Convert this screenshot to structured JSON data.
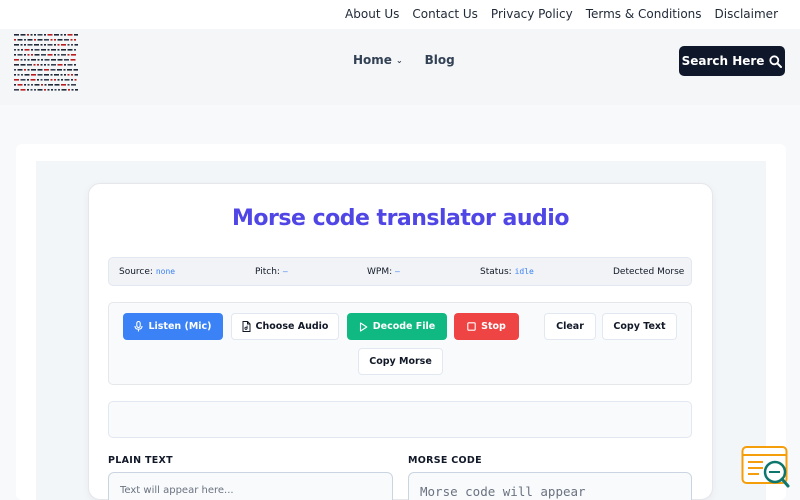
{
  "topnav": [
    "About Us",
    "Contact Us",
    "Privacy Policy",
    "Terms & Conditions",
    "Disclaimer"
  ],
  "header": {
    "nav": {
      "home": "Home",
      "blog": "Blog"
    },
    "search_label": "Search Here"
  },
  "app": {
    "title": "Morse code translator audio",
    "status": {
      "source_label": "Source:",
      "source_value": "none",
      "pitch_label": "Pitch:",
      "pitch_value": "–",
      "wpm_label": "WPM:",
      "wpm_value": "–",
      "status_label": "Status:",
      "status_value": "idle",
      "detected_label": "Detected Morse"
    },
    "buttons": {
      "listen": "Listen (Mic)",
      "choose_audio": "Choose Audio",
      "decode_file": "Decode File",
      "stop": "Stop",
      "clear": "Clear",
      "copy_text": "Copy Text",
      "copy_morse": "Copy Morse"
    },
    "plain_label": "PLAIN TEXT",
    "plain_placeholder": "Text will appear here...",
    "morse_label": "MORSE CODE",
    "morse_placeholder": "Morse code will appear"
  },
  "colors": {
    "accent": "#4f46e5",
    "blue": "#3b82f6",
    "green": "#10b981",
    "red": "#ef4444",
    "dark": "#0f172a"
  }
}
